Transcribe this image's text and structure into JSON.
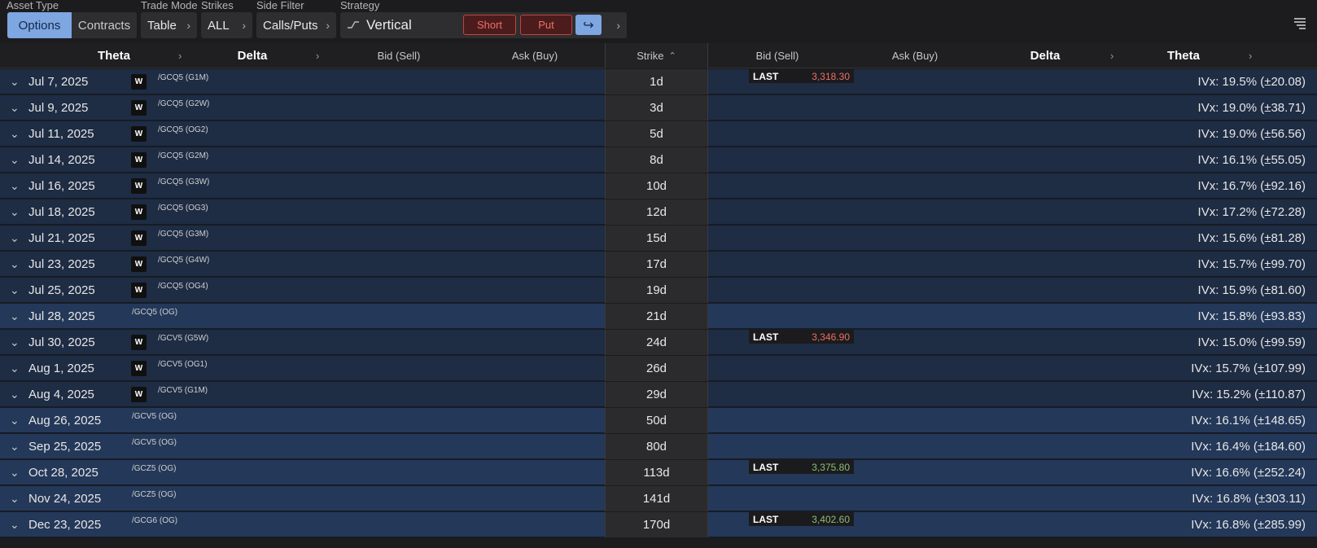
{
  "toolbar": {
    "asset_type_label": "Asset Type",
    "asset_options": "Options",
    "asset_contracts": "Contracts",
    "trade_mode_label": "Trade Mode",
    "trade_mode_value": "Table",
    "strikes_label": "Strikes",
    "strikes_value": "ALL",
    "side_filter_label": "Side Filter",
    "side_filter_value": "Calls/Puts",
    "strategy_label": "Strategy",
    "strategy_icon": "vertical-curve-icon",
    "strategy_value": "Vertical",
    "short_label": "Short",
    "put_label": "Put",
    "swap_glyph": "↪"
  },
  "header": {
    "left_theta": "Theta",
    "left_delta": "Delta",
    "left_bid": "Bid (Sell)",
    "left_ask": "Ask (Buy)",
    "strike": "Strike",
    "strike_sort": "⌃",
    "right_bid": "Bid (Sell)",
    "right_ask": "Ask (Buy)",
    "right_delta": "Delta",
    "right_theta": "Theta"
  },
  "colors": {
    "weekly_row": "#1e2c44",
    "monthly_row": "#243859",
    "last_down": "#ef6e66",
    "last_up": "#8fbf7a",
    "accent_blue": "#7ea6e0"
  },
  "rows": [
    {
      "date": "Jul 7, 2025",
      "weekly": true,
      "symbol": "/GCQ5 (G1M)",
      "dte": "1d",
      "ivx": "IVx: 19.5% (±20.08)",
      "last": "3,318.30",
      "last_dir": "down"
    },
    {
      "date": "Jul 9, 2025",
      "weekly": true,
      "symbol": "/GCQ5 (G2W)",
      "dte": "3d",
      "ivx": "IVx: 19.0% (±38.71)"
    },
    {
      "date": "Jul 11, 2025",
      "weekly": true,
      "symbol": "/GCQ5 (OG2)",
      "dte": "5d",
      "ivx": "IVx: 19.0% (±56.56)"
    },
    {
      "date": "Jul 14, 2025",
      "weekly": true,
      "symbol": "/GCQ5 (G2M)",
      "dte": "8d",
      "ivx": "IVx: 16.1% (±55.05)"
    },
    {
      "date": "Jul 16, 2025",
      "weekly": true,
      "symbol": "/GCQ5 (G3W)",
      "dte": "10d",
      "ivx": "IVx: 16.7% (±92.16)"
    },
    {
      "date": "Jul 18, 2025",
      "weekly": true,
      "symbol": "/GCQ5 (OG3)",
      "dte": "12d",
      "ivx": "IVx: 17.2% (±72.28)"
    },
    {
      "date": "Jul 21, 2025",
      "weekly": true,
      "symbol": "/GCQ5 (G3M)",
      "dte": "15d",
      "ivx": "IVx: 15.6% (±81.28)"
    },
    {
      "date": "Jul 23, 2025",
      "weekly": true,
      "symbol": "/GCQ5 (G4W)",
      "dte": "17d",
      "ivx": "IVx: 15.7% (±99.70)"
    },
    {
      "date": "Jul 25, 2025",
      "weekly": true,
      "symbol": "/GCQ5 (OG4)",
      "dte": "19d",
      "ivx": "IVx: 15.9% (±81.60)"
    },
    {
      "date": "Jul 28, 2025",
      "weekly": false,
      "symbol": "/GCQ5 (OG)",
      "dte": "21d",
      "ivx": "IVx: 15.8% (±93.83)"
    },
    {
      "date": "Jul 30, 2025",
      "weekly": true,
      "symbol": "/GCV5 (G5W)",
      "dte": "24d",
      "ivx": "IVx: 15.0% (±99.59)",
      "last": "3,346.90",
      "last_dir": "down"
    },
    {
      "date": "Aug 1, 2025",
      "weekly": true,
      "symbol": "/GCV5 (OG1)",
      "dte": "26d",
      "ivx": "IVx: 15.7% (±107.99)"
    },
    {
      "date": "Aug 4, 2025",
      "weekly": true,
      "symbol": "/GCV5 (G1M)",
      "dte": "29d",
      "ivx": "IVx: 15.2% (±110.87)"
    },
    {
      "date": "Aug 26, 2025",
      "weekly": false,
      "symbol": "/GCV5 (OG)",
      "dte": "50d",
      "ivx": "IVx: 16.1% (±148.65)"
    },
    {
      "date": "Sep 25, 2025",
      "weekly": false,
      "symbol": "/GCV5 (OG)",
      "dte": "80d",
      "ivx": "IVx: 16.4% (±184.60)"
    },
    {
      "date": "Oct 28, 2025",
      "weekly": false,
      "symbol": "/GCZ5 (OG)",
      "dte": "113d",
      "ivx": "IVx: 16.6% (±252.24)",
      "last": "3,375.80",
      "last_dir": "up"
    },
    {
      "date": "Nov 24, 2025",
      "weekly": false,
      "symbol": "/GCZ5 (OG)",
      "dte": "141d",
      "ivx": "IVx: 16.8% (±303.11)"
    },
    {
      "date": "Dec 23, 2025",
      "weekly": false,
      "symbol": "/GCG6 (OG)",
      "dte": "170d",
      "ivx": "IVx: 16.8% (±285.99)",
      "last": "3,402.60",
      "last_dir": "up"
    }
  ],
  "last_label": "LAST",
  "weekly_badge": "W",
  "expand_glyph": "⌄",
  "chevron_glyph": "›"
}
